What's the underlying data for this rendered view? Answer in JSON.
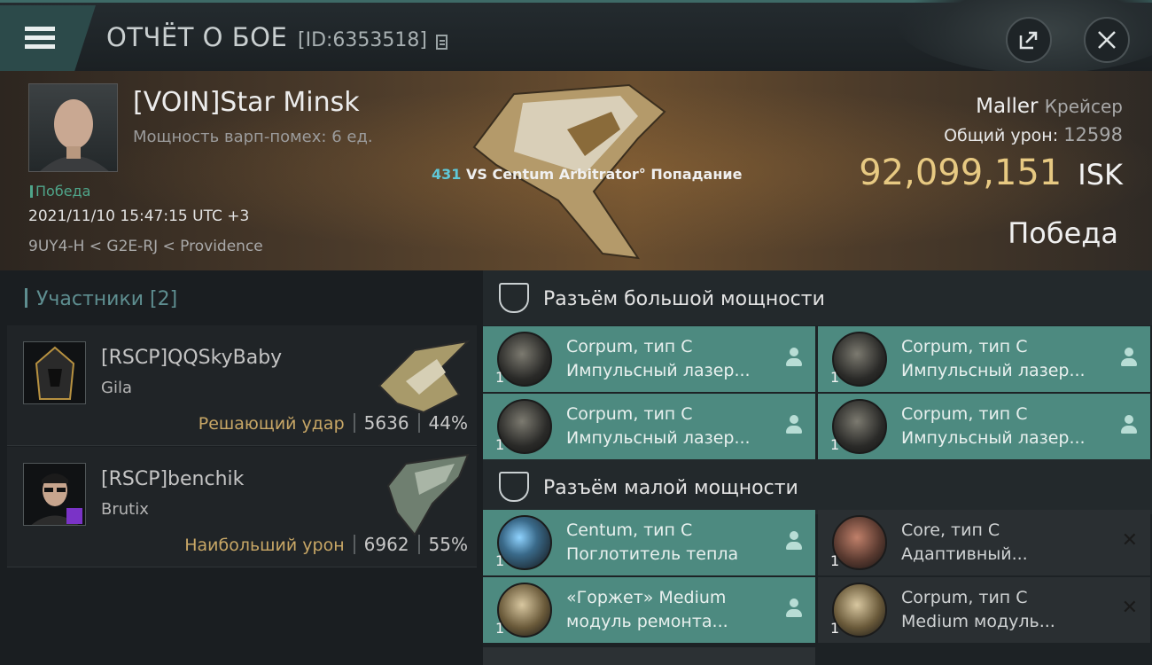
{
  "header": {
    "title": "ОТЧЁТ О БОЕ",
    "report_id": "[ID:6353518]"
  },
  "victim": {
    "name": "[VOIN]Star Minsk",
    "warp_disruption": "Мощность варп-помех: 6 ед.",
    "result_small": "Победа",
    "datetime": "2021/11/10 15:47:15 UTC +3",
    "location": "9UY4-H < G2E-RJ < Providence",
    "ship_name": "Maller",
    "ship_class": "Крейсер",
    "total_damage_label": "Общий урон:",
    "total_damage_value": "12598",
    "isk_value": "92,099,151",
    "isk_unit": "ISK",
    "result": "Победа"
  },
  "hit": {
    "number": "431",
    "text": "VS Centum Arbitrator° Попадание"
  },
  "participants": {
    "heading": "Участники [2]",
    "rows": [
      {
        "name": "[RSCP]QQSkyBaby",
        "ship": "Gila",
        "role": "Решающий удар",
        "damage": "5636",
        "percent": "44%"
      },
      {
        "name": "[RSCP]benchik",
        "ship": "Brutix",
        "role": "Наибольший урон",
        "damage": "6962",
        "percent": "55%"
      }
    ]
  },
  "high_slots": {
    "title": "Разъём большой мощности",
    "modules": [
      {
        "qty": "1",
        "line1": "Corpum, тип C",
        "line2": "Импульсный лазер..."
      },
      {
        "qty": "1",
        "line1": "Corpum, тип C",
        "line2": "Импульсный лазер..."
      },
      {
        "qty": "1",
        "line1": "Corpum, тип C",
        "line2": "Импульсный лазер..."
      },
      {
        "qty": "1",
        "line1": "Corpum, тип C",
        "line2": "Импульсный лазер..."
      }
    ]
  },
  "low_slots": {
    "title": "Разъём малой мощности",
    "modules": [
      {
        "qty": "1",
        "line1": "Centum, тип C",
        "line2": "Поглотитель тепла",
        "status": "dropped"
      },
      {
        "qty": "1",
        "line1": "Core, тип C",
        "line2": "Адаптивный...",
        "status": "destroyed"
      },
      {
        "qty": "1",
        "line1": "«Горжет» Medium",
        "line2": "модуль ремонта...",
        "status": "dropped"
      },
      {
        "qty": "1",
        "line1": "Corpum, тип C",
        "line2": "Medium модуль...",
        "status": "destroyed"
      }
    ]
  },
  "colors": {
    "accent_teal": "#4d8a80",
    "isk_gold": "#e7c982",
    "role_gold": "#c8a766",
    "hit_number": "#5fc8d8"
  }
}
